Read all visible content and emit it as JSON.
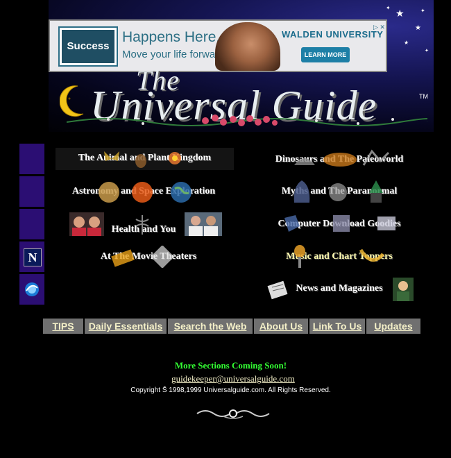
{
  "ad": {
    "box_text": "Success",
    "headline": "Happens Here.",
    "subline": "Move your life forward.",
    "brand": "WALDEN UNIVERSITY",
    "cta": "LEARN MORE",
    "close": "▷ ✕"
  },
  "logo": {
    "the": "The",
    "main": "Universal Guide",
    "tm": "TM"
  },
  "sections": {
    "animal": "The Animal and Plant Kingdom",
    "dinosaurs": "Dinosaurs and The Paleoworld",
    "astronomy": "Astronomy and Space Exploration",
    "myths": "Myths and The Paranormal",
    "health": "Health and You",
    "computer": "Computer Download Goodies",
    "movies": "At The Movie Theaters",
    "music": "Music and Chart Toppers",
    "news": "News and Magazines"
  },
  "side_icons": {
    "netscape": "N"
  },
  "nav": [
    "TIPS",
    "Daily Essentials",
    "Search the Web",
    "About Us",
    "Link To Us",
    "Updates"
  ],
  "footer": {
    "coming_soon": "More Sections Coming Soon!",
    "email": "guidekeeper@universalguide.com",
    "copyright": "Copyright Š 1998,1999 Universalguide.com. All Rights Reserved."
  },
  "colors": {
    "side_box": "#2b0e73",
    "nav_bg": "#707070",
    "nav_text": "#f4f0c8",
    "coming_soon": "#33ff33"
  }
}
